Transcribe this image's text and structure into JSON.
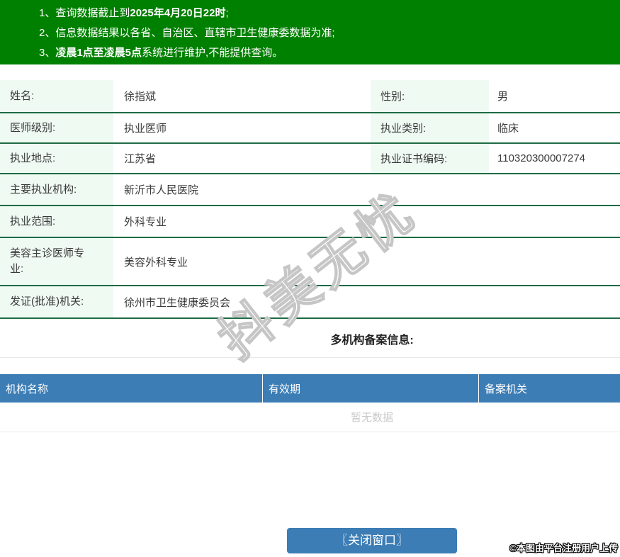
{
  "notice": {
    "line1": {
      "num": "1、",
      "pre": "查询数据截止到",
      "bold": "2025年4月20日22时",
      "post": ";"
    },
    "line2": {
      "num": "2、",
      "text": "信息数据结果以各省、自治区、直辖市卫生健康委数据为准;"
    },
    "line3": {
      "num": "3、",
      "bold": "凌晨1点至凌晨5点",
      "post": "系统进行维护,不能提供查询。"
    }
  },
  "info": {
    "name_label": "姓名:",
    "name_value": "徐指斌",
    "gender_label": "性别:",
    "gender_value": "男",
    "level_label": "医师级别:",
    "level_value": "执业医师",
    "category_label": "执业类别:",
    "category_value": "临床",
    "location_label": "执业地点:",
    "location_value": "江苏省",
    "cert_label": "执业证书编码:",
    "cert_value": "110320300007274",
    "org_label": "主要执业机构:",
    "org_value": "新沂市人民医院",
    "scope_label": "执业范围:",
    "scope_value": "外科专业",
    "cosmetic_label": "美容主诊医师专业:",
    "cosmetic_value": "美容外科专业",
    "issuer_label": "发证(批准)机关:",
    "issuer_value": "徐州市卫生健康委员会"
  },
  "filing": {
    "title": "多机构备案信息:",
    "columns": [
      "机构名称",
      "有效期",
      "备案机关"
    ],
    "empty_text": "暂无数据"
  },
  "footer": {
    "close_label": "〖关闭窗口〗"
  },
  "watermark": {
    "diagonal": "抖美无忧",
    "credit": "©本图由平台注册用户上传"
  },
  "colors": {
    "banner_green": "#008000",
    "label_bg_mint": "#effaf3",
    "row_border_green": "#1e6b44",
    "table_header_blue": "#3c7db5",
    "button_blue": "#3c7db5",
    "empty_text_gray": "#c9c9c9"
  }
}
